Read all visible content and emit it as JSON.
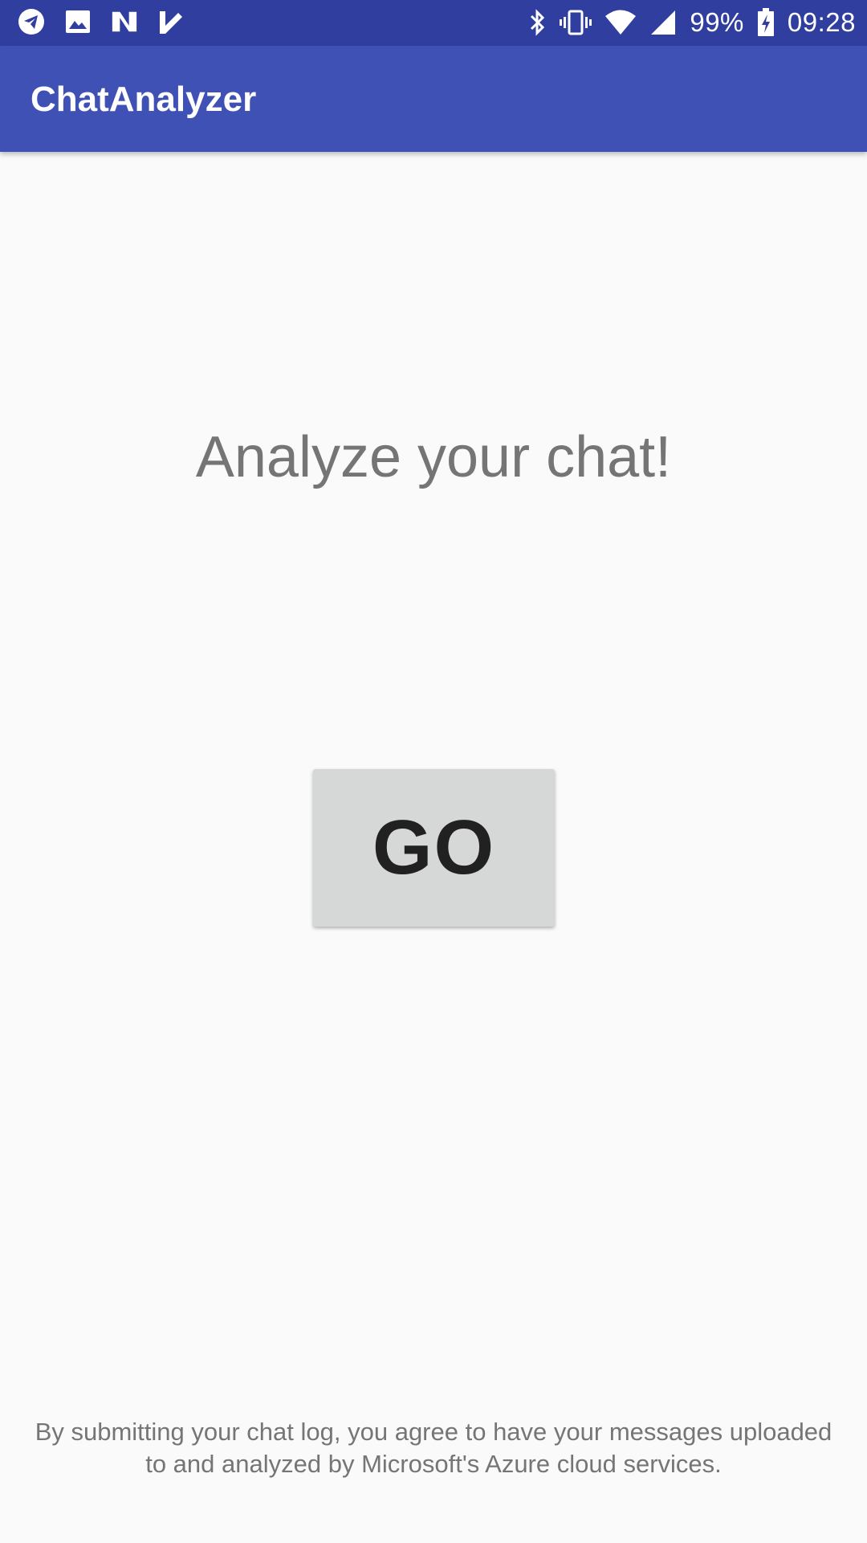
{
  "status_bar": {
    "left_icons": [
      "telegram-icon",
      "image-icon",
      "news-icon",
      "task-check-icon"
    ],
    "right_icons": [
      "bluetooth-icon",
      "vibrate-icon",
      "wifi-icon",
      "signal-icon"
    ],
    "battery_percent": "99%",
    "time": "09:28"
  },
  "app_bar": {
    "title": "ChatAnalyzer"
  },
  "main": {
    "headline": "Analyze your chat!",
    "go_button_label": "GO",
    "disclaimer_line1": "By submitting your chat log, you agree to have your messages uploaded",
    "disclaimer_line2": "to and analyzed by Microsoft's Azure cloud services."
  },
  "colors": {
    "status_bar": "#303f9f",
    "app_bar": "#3f51b5",
    "background": "#fafafa",
    "button": "#d6d7d7"
  }
}
